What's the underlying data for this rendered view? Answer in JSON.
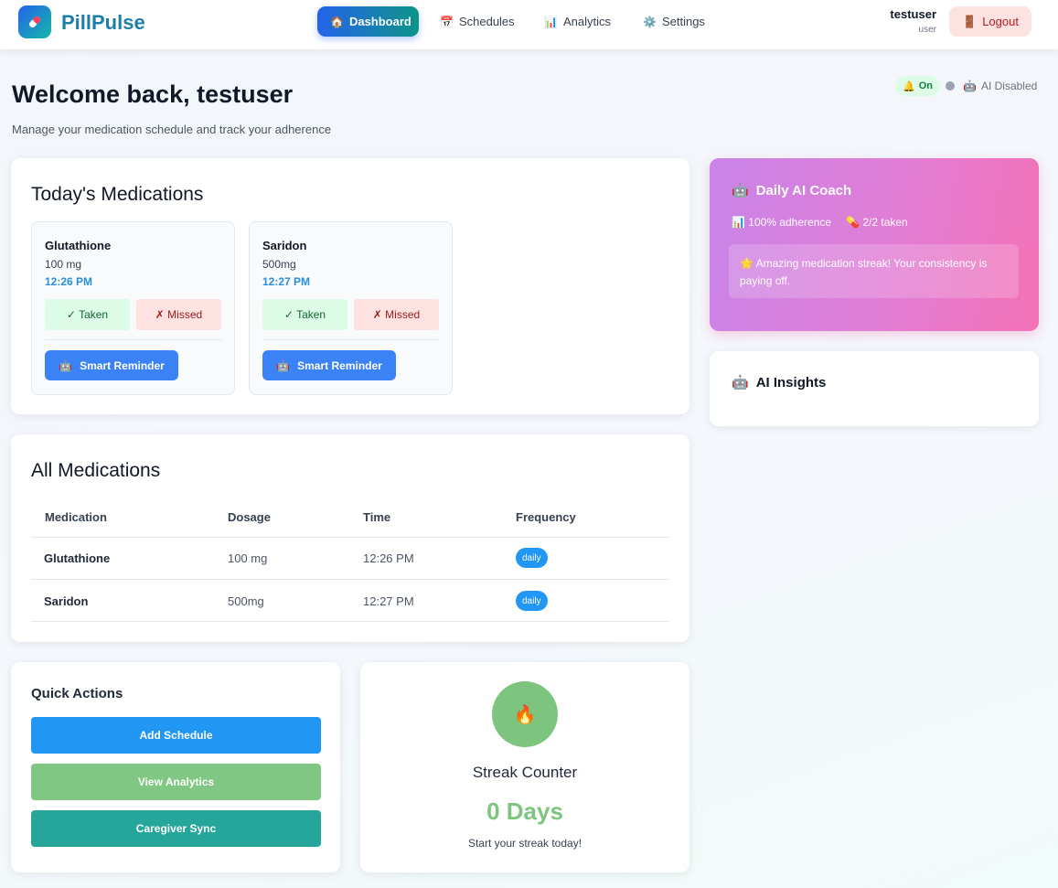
{
  "header": {
    "brand": "PillPulse",
    "nav": [
      {
        "icon": "🏠",
        "label": "Dashboard",
        "active": true
      },
      {
        "icon": "📅",
        "label": "Schedules",
        "active": false
      },
      {
        "icon": "📊",
        "label": "Analytics",
        "active": false
      },
      {
        "icon": "⚙️",
        "label": "Settings",
        "active": false
      }
    ],
    "user_name": "testuser",
    "user_role": "user",
    "logout_icon": "🚪",
    "logout_label": "Logout"
  },
  "welcome": {
    "title": "Welcome back, testuser",
    "subtitle": "Manage your medication schedule and track your adherence",
    "notifications_icon": "🔔",
    "notifications_label": "On",
    "ai_icon": "🤖",
    "ai_status": "AI Disabled"
  },
  "today": {
    "title": "Today's Medications",
    "taken_label": "✓ Taken",
    "missed_label": "✗ Missed",
    "reminder_icon": "🤖",
    "reminder_label": "Smart Reminder",
    "meds": [
      {
        "name": "Glutathione",
        "dosage": "100 mg",
        "time": "12:26 PM"
      },
      {
        "name": "Saridon",
        "dosage": "500mg",
        "time": "12:27 PM"
      }
    ]
  },
  "all_meds": {
    "title": "All Medications",
    "columns": [
      "Medication",
      "Dosage",
      "Time",
      "Frequency"
    ],
    "rows": [
      {
        "name": "Glutathione",
        "dosage": "100 mg",
        "time": "12:26 PM",
        "frequency": "daily"
      },
      {
        "name": "Saridon",
        "dosage": "500mg",
        "time": "12:27 PM",
        "frequency": "daily"
      }
    ]
  },
  "coach": {
    "icon": "🤖",
    "title": "Daily AI Coach",
    "adherence_icon": "📊",
    "adherence": "100% adherence",
    "taken_icon": "💊",
    "taken": "2/2 taken",
    "message_icon": "🌟",
    "message": "Amazing medication streak! Your consistency is paying off."
  },
  "insights": {
    "icon": "🤖",
    "title": "AI Insights"
  },
  "quick_actions": {
    "title": "Quick Actions",
    "buttons": [
      {
        "label": "Add Schedule",
        "color": "#2196f3"
      },
      {
        "label": "View Analytics",
        "color": "#81c784"
      },
      {
        "label": "Caregiver Sync",
        "color": "#26a69a"
      }
    ]
  },
  "streak": {
    "icon": "🔥",
    "title": "Streak Counter",
    "value": "0 Days",
    "caption": "Start your streak today!",
    "color": "#7dc47f"
  },
  "colors": {
    "brand": "#1d7fa8",
    "primary": "#3b82f6",
    "coach_gradient_start": "#c984e8",
    "coach_gradient_end": "#f472b6"
  }
}
